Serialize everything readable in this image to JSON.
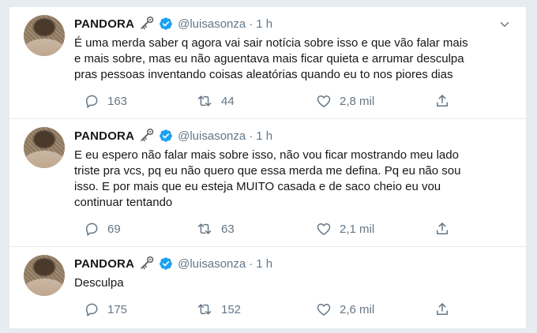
{
  "tweets": [
    {
      "name": "PANDORA",
      "handle": "@luisasonza",
      "separator": "·",
      "time": "1 h",
      "lines": [
        "É uma merda saber q agora vai sair notícia sobre isso e que vão falar mais",
        "e mais sobre, mas eu não aguentava mais ficar quieta e arrumar desculpa",
        "pras pessoas inventando coisas aleatórias quando eu to nos piores dias"
      ],
      "replies": "163",
      "retweets": "44",
      "likes": "2,8 mil"
    },
    {
      "name": "PANDORA",
      "handle": "@luisasonza",
      "separator": "·",
      "time": "1 h",
      "lines": [
        "E eu espero não falar mais sobre isso, não vou ficar mostrando meu lado",
        "triste pra vcs, pq eu não quero que essa merda me defina. Pq eu não sou",
        "isso. E por mais que eu esteja MUITO casada e de saco cheio eu vou",
        "continuar tentando"
      ],
      "replies": "69",
      "retweets": "63",
      "likes": "2,1 mil"
    },
    {
      "name": "PANDORA",
      "handle": "@luisasonza",
      "separator": "·",
      "time": "1 h",
      "lines": [
        "Desculpa"
      ],
      "replies": "175",
      "retweets": "152",
      "likes": "2,6 mil"
    }
  ],
  "colors": {
    "background": "#e6ecf0",
    "card": "#ffffff",
    "text": "#14171a",
    "muted": "#657786",
    "verified": "#1da1f2"
  },
  "icons": [
    "key-icon",
    "verified-badge-icon",
    "chevron-down-icon",
    "reply-icon",
    "retweet-icon",
    "like-icon",
    "share-icon"
  ]
}
